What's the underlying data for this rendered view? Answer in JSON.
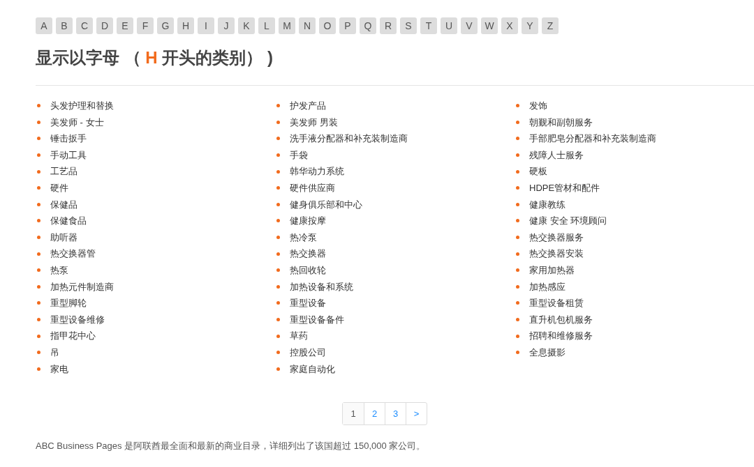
{
  "letters": [
    "A",
    "B",
    "C",
    "D",
    "E",
    "F",
    "G",
    "H",
    "I",
    "J",
    "K",
    "L",
    "M",
    "N",
    "O",
    "P",
    "Q",
    "R",
    "S",
    "T",
    "U",
    "V",
    "W",
    "X",
    "Y",
    "Z"
  ],
  "heading": {
    "prefix": "显示以字母 （",
    "letter": "H",
    "suffix": "开头的类别） )"
  },
  "columns": [
    [
      "头发护理和替换",
      "美发师 - 女士",
      "锤击扳手",
      "手动工具",
      "工艺品",
      "硬件",
      "保健品",
      "保健食品",
      "助听器",
      "热交换器管",
      "热泵",
      "加热元件制造商",
      "重型脚轮",
      "重型设备维修",
      "指甲花中心",
      "吊",
      "家电"
    ],
    [
      "护发产品",
      "美发师 男装",
      "洗手液分配器和补充装制造商",
      "手袋",
      "韩华动力系统",
      "硬件供应商",
      "健身俱乐部和中心",
      "健康按摩",
      "热冷泵",
      "热交换器",
      "热回收轮",
      "加热设备和系统",
      "重型设备",
      "重型设备备件",
      "草药",
      "控股公司",
      "家庭自动化"
    ],
    [
      "发饰",
      "朝觐和副朝服务",
      "手部肥皂分配器和补充装制造商",
      "残障人士服务",
      "硬板",
      "HDPE管材和配件",
      "健康教练",
      "健康 安全 环境顾问",
      "热交换器服务",
      "热交换器安装",
      "家用加热器",
      "加热感应",
      "重型设备租赁",
      "直升机包机服务",
      "招聘和维修服务",
      "全息摄影"
    ]
  ],
  "pagination": [
    {
      "label": "1",
      "selected": true
    },
    {
      "label": "2",
      "selected": false
    },
    {
      "label": "3",
      "selected": false
    },
    {
      "label": ">",
      "selected": false
    }
  ],
  "footer": "ABC Business Pages 是阿联酋最全面和最新的商业目录，详细列出了该国超过 150,000 家公司。"
}
